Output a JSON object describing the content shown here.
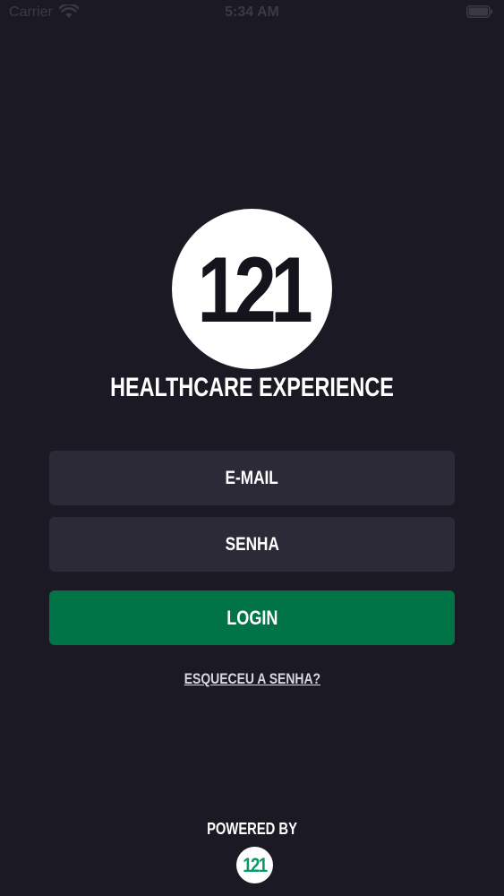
{
  "status_bar": {
    "carrier": "Carrier",
    "time": "5:34 AM",
    "wifi_icon": "wifi-icon",
    "battery_icon": "battery-icon"
  },
  "brand": {
    "logo_text": "121",
    "tagline": "HEALTHCARE EXPERIENCE"
  },
  "form": {
    "email_placeholder": "E-MAIL",
    "password_placeholder": "SENHA",
    "login_label": "LOGIN",
    "forgot_password": "ESQUECEU A SENHA?"
  },
  "footer": {
    "powered_by": "POWERED BY",
    "logo_text": "121"
  },
  "colors": {
    "background": "#1b1a24",
    "field": "#2b2a36",
    "accent": "#007447",
    "footer_logo": "#0a9a6a"
  }
}
